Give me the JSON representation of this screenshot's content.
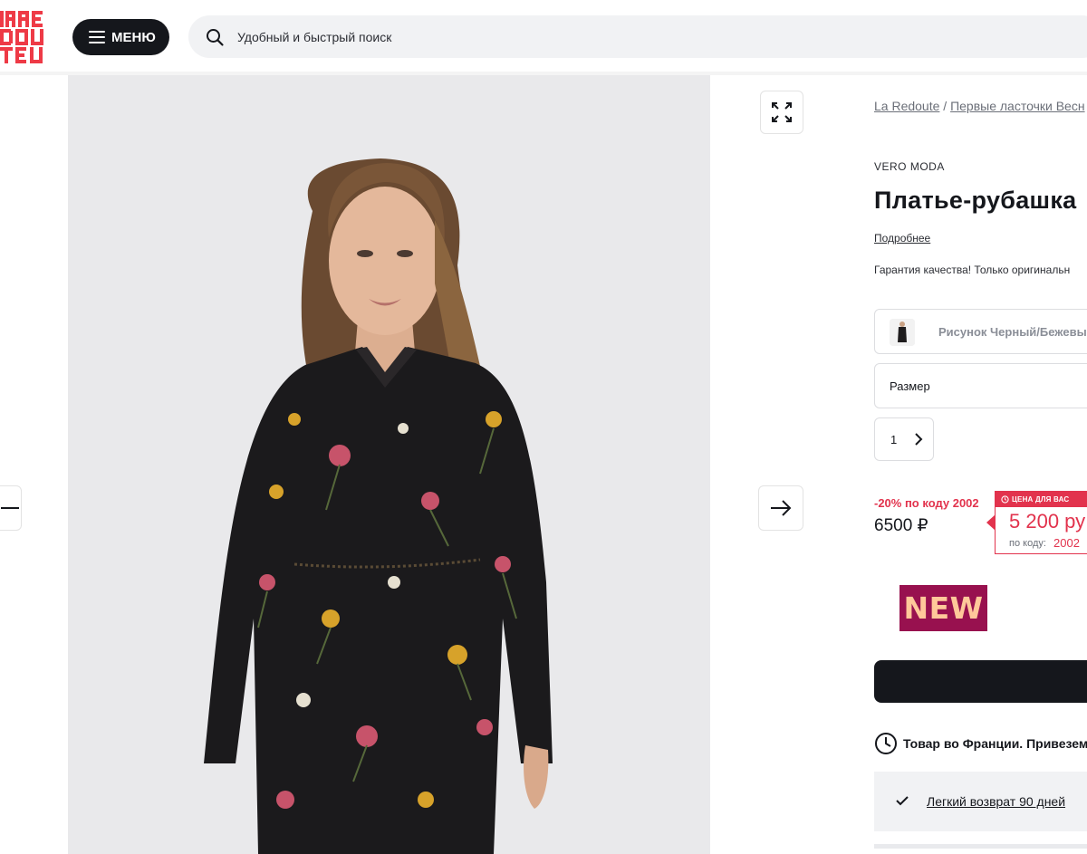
{
  "header": {
    "logo_text": "LA REDOUTE",
    "menu_label": "МЕНЮ",
    "search_placeholder": "Удобный и быстрый поиск"
  },
  "breadcrumb": {
    "items": [
      "La Redoute",
      "Первые ласточки Весн"
    ],
    "separator": "/"
  },
  "product": {
    "brand": "VERO MODA",
    "title": "Платье-рубашка",
    "details_link": "Подробнее",
    "guarantee": "Гарантия качества! Только оригинальн",
    "color_label": "Рисунок Черный/Бежевый",
    "size_label": "Размер",
    "quantity": "1"
  },
  "pricing": {
    "discount_text": "-20% по коду 2002",
    "old_price": "6500 ₽",
    "card_header": "ЦЕНА ДЛЯ ВАС",
    "new_price": "5 200 ру",
    "code_label": "по коду:",
    "code_value": "2002"
  },
  "badge": {
    "text": "NEW"
  },
  "delivery": {
    "text": "Товар во Франции. Привезем"
  },
  "returns": {
    "text": "Легкий возврат 90 дней"
  },
  "colors": {
    "accent": "#e2334d",
    "dark": "#15171c",
    "badge_bg": "#98114f",
    "badge_text": "#ffc89a",
    "logo": "#ee3a46"
  },
  "icons": [
    "hamburger-icon",
    "search-icon",
    "expand-icon",
    "arrow-right-icon",
    "arrow-left-icon",
    "chevron-right-icon",
    "clock-icon",
    "check-icon"
  ]
}
